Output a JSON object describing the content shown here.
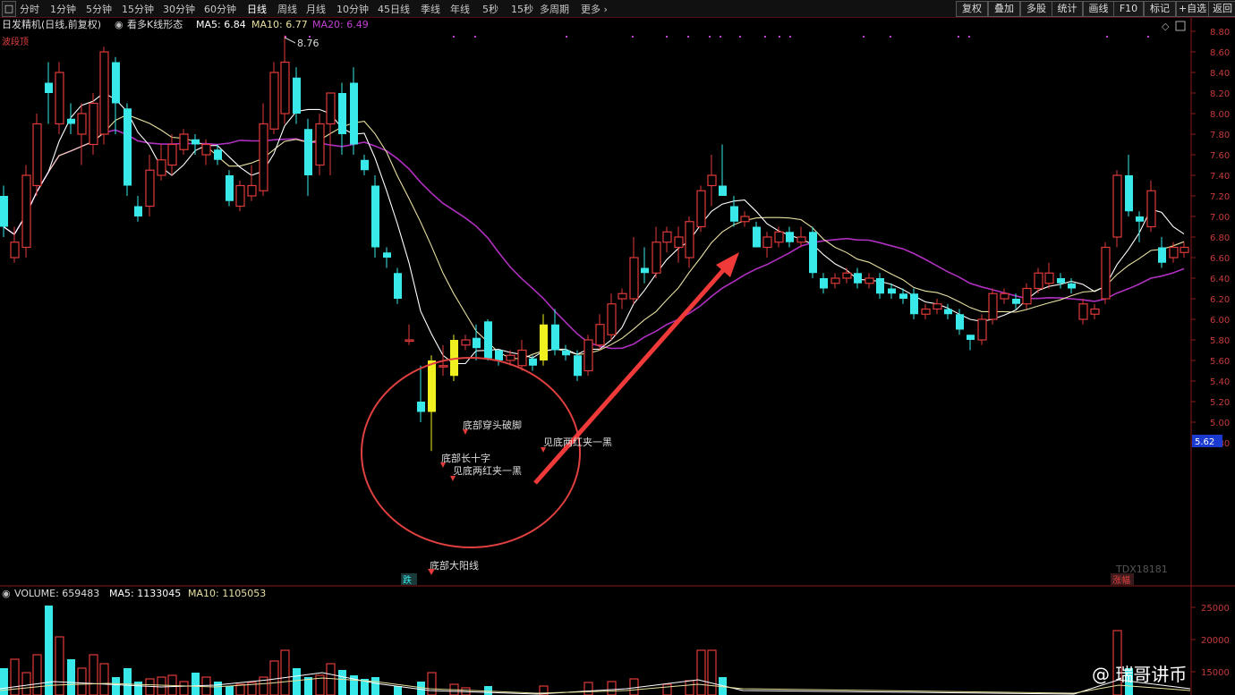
{
  "toolbar": {
    "periods": [
      "分时",
      "1分钟",
      "5分钟",
      "15分钟",
      "30分钟",
      "60分钟",
      "日线",
      "周线",
      "月线",
      "10分钟",
      "45日线",
      "季线",
      "年线",
      "5秒",
      "15秒",
      "多周期",
      "更多 ›"
    ],
    "active_period": "日线",
    "right_buttons": [
      "复权",
      "叠加",
      "多股",
      "统计",
      "画线",
      "F10",
      "标记",
      "+自选",
      "返回"
    ]
  },
  "info": {
    "stock_name": "日发精机(日线,前复权)",
    "pattern_label": "看多K线形态",
    "ma5": "MA5: 6.84",
    "ma10": "MA10: 6.77",
    "ma20": "MA20: 6.49"
  },
  "tags": {
    "top_left": "波段顶",
    "high_price": "8.76",
    "current_price": "5.62",
    "bottom_tag": "跌",
    "right_tag": "涨幅",
    "tdx": "TDX18181"
  },
  "annotations": {
    "a1": "底部穿头破脚",
    "a2": "底部长十字",
    "a3": "见底两红夹一黑",
    "a4": "见底两红夹一黑",
    "a5": "底部大阳线"
  },
  "price_axis": [
    "8.80",
    "8.60",
    "8.40",
    "8.20",
    "8.00",
    "7.80",
    "7.60",
    "7.40",
    "7.20",
    "7.00",
    "6.80",
    "6.60",
    "6.40",
    "6.20",
    "6.00",
    "5.80",
    "5.60",
    "5.40",
    "5.20",
    "5.00",
    "4.80"
  ],
  "volume": {
    "label": "VOLUME: 659483",
    "ma5": "MA5: 1133045",
    "ma10": "MA10: 1105053",
    "axis": [
      "25000",
      "20000",
      "15000"
    ]
  },
  "watermark": "@ 瑞哥讲币",
  "colors": {
    "up": "#e03a3a",
    "down": "#39e8e8",
    "ma5": "#ffffff",
    "ma10": "#e8e0a0",
    "ma20": "#b030c0",
    "pattern": "#f0f020"
  }
}
